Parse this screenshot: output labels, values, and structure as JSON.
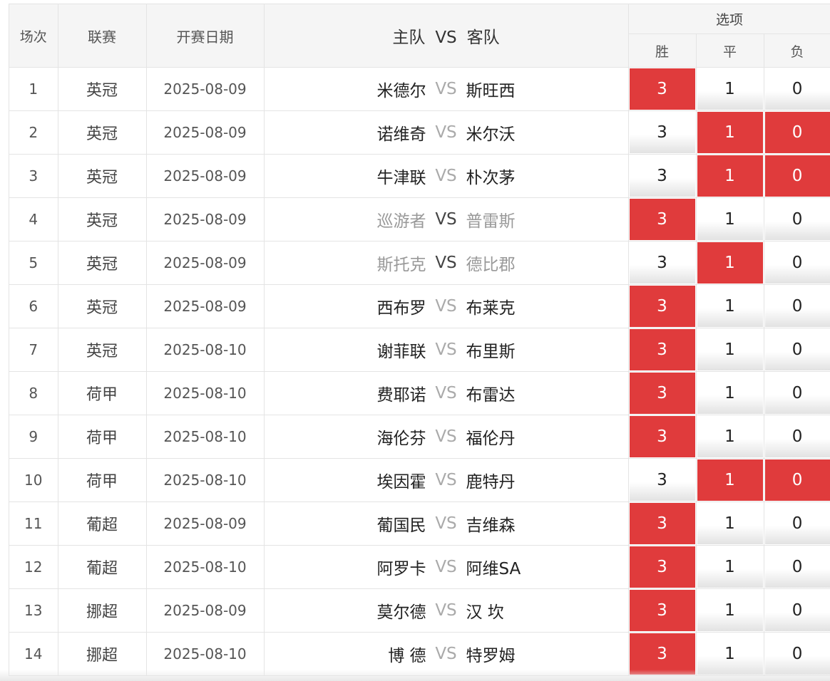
{
  "header": {
    "col_index": "场次",
    "col_league": "联赛",
    "col_date": "开赛日期",
    "col_home": "主队",
    "col_vs": "VS",
    "col_away": "客队",
    "col_options": "选项",
    "opt_win": "胜",
    "opt_draw": "平",
    "opt_loss": "负"
  },
  "colors": {
    "selected": "#e03b3c",
    "selected_text": "#ffffff"
  },
  "rows": [
    {
      "idx": "1",
      "league": "英冠",
      "date": "2025-08-09",
      "home": "米德尔",
      "vs": "VS",
      "away": "斯旺西",
      "muted": false,
      "opts": [
        "3",
        "1",
        "0"
      ],
      "selected": [
        true,
        false,
        false
      ]
    },
    {
      "idx": "2",
      "league": "英冠",
      "date": "2025-08-09",
      "home": "诺维奇",
      "vs": "VS",
      "away": "米尔沃",
      "muted": false,
      "opts": [
        "3",
        "1",
        "0"
      ],
      "selected": [
        false,
        true,
        true
      ]
    },
    {
      "idx": "3",
      "league": "英冠",
      "date": "2025-08-09",
      "home": "牛津联",
      "vs": "VS",
      "away": "朴次茅",
      "muted": false,
      "opts": [
        "3",
        "1",
        "0"
      ],
      "selected": [
        false,
        true,
        true
      ]
    },
    {
      "idx": "4",
      "league": "英冠",
      "date": "2025-08-09",
      "home": "巡游者",
      "vs": "VS",
      "away": "普雷斯",
      "muted": true,
      "opts": [
        "3",
        "1",
        "0"
      ],
      "selected": [
        true,
        false,
        false
      ]
    },
    {
      "idx": "5",
      "league": "英冠",
      "date": "2025-08-09",
      "home": "斯托克",
      "vs": "VS",
      "away": "德比郡",
      "muted": true,
      "opts": [
        "3",
        "1",
        "0"
      ],
      "selected": [
        false,
        true,
        false
      ]
    },
    {
      "idx": "6",
      "league": "英冠",
      "date": "2025-08-09",
      "home": "西布罗",
      "vs": "VS",
      "away": "布莱克",
      "muted": false,
      "opts": [
        "3",
        "1",
        "0"
      ],
      "selected": [
        true,
        false,
        false
      ]
    },
    {
      "idx": "7",
      "league": "英冠",
      "date": "2025-08-10",
      "home": "谢菲联",
      "vs": "VS",
      "away": "布里斯",
      "muted": false,
      "opts": [
        "3",
        "1",
        "0"
      ],
      "selected": [
        true,
        false,
        false
      ]
    },
    {
      "idx": "8",
      "league": "荷甲",
      "date": "2025-08-10",
      "home": "费耶诺",
      "vs": "VS",
      "away": "布雷达",
      "muted": false,
      "opts": [
        "3",
        "1",
        "0"
      ],
      "selected": [
        true,
        false,
        false
      ]
    },
    {
      "idx": "9",
      "league": "荷甲",
      "date": "2025-08-10",
      "home": "海伦芬",
      "vs": "VS",
      "away": "福伦丹",
      "muted": false,
      "opts": [
        "3",
        "1",
        "0"
      ],
      "selected": [
        true,
        false,
        false
      ]
    },
    {
      "idx": "10",
      "league": "荷甲",
      "date": "2025-08-10",
      "home": "埃因霍",
      "vs": "VS",
      "away": "鹿特丹",
      "muted": false,
      "opts": [
        "3",
        "1",
        "0"
      ],
      "selected": [
        false,
        true,
        true
      ]
    },
    {
      "idx": "11",
      "league": "葡超",
      "date": "2025-08-09",
      "home": "葡国民",
      "vs": "VS",
      "away": "吉维森",
      "muted": false,
      "opts": [
        "3",
        "1",
        "0"
      ],
      "selected": [
        true,
        false,
        false
      ]
    },
    {
      "idx": "12",
      "league": "葡超",
      "date": "2025-08-10",
      "home": "阿罗卡",
      "vs": "VS",
      "away": "阿维SA",
      "muted": false,
      "opts": [
        "3",
        "1",
        "0"
      ],
      "selected": [
        true,
        false,
        false
      ]
    },
    {
      "idx": "13",
      "league": "挪超",
      "date": "2025-08-09",
      "home": "莫尔德",
      "vs": "VS",
      "away": "汉 坎",
      "muted": false,
      "opts": [
        "3",
        "1",
        "0"
      ],
      "selected": [
        true,
        false,
        false
      ]
    },
    {
      "idx": "14",
      "league": "挪超",
      "date": "2025-08-10",
      "home": "博 德",
      "vs": "VS",
      "away": "特罗姆",
      "muted": false,
      "opts": [
        "3",
        "1",
        "0"
      ],
      "selected": [
        true,
        false,
        false
      ]
    }
  ]
}
